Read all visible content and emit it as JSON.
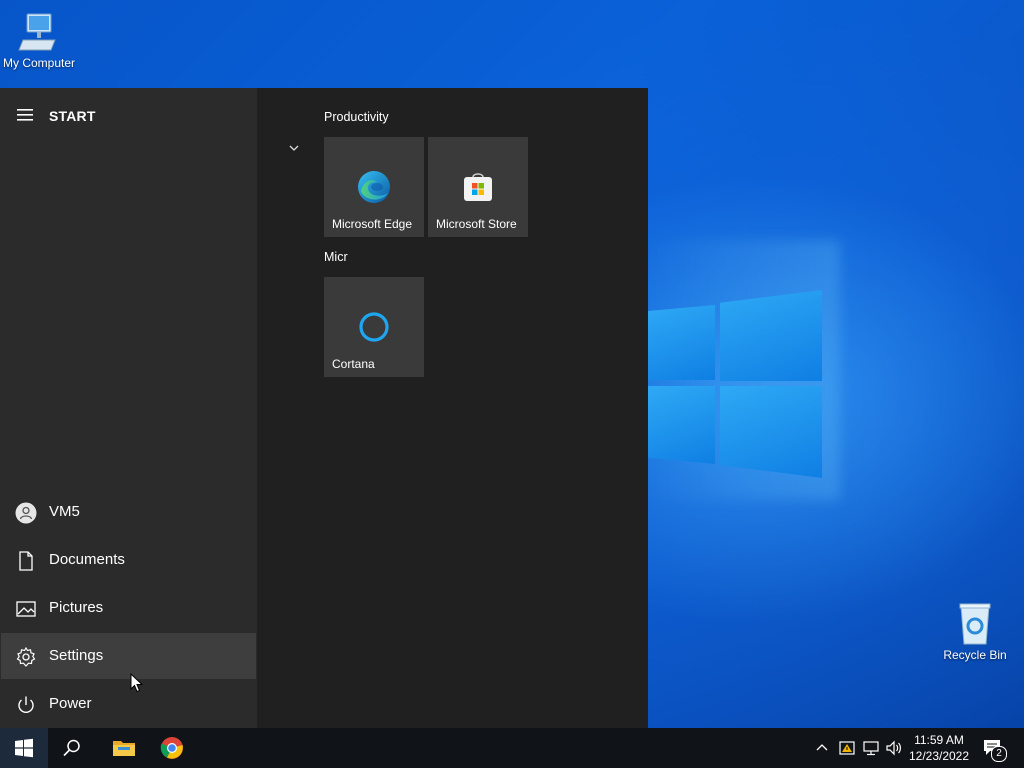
{
  "desktop": {
    "icons": [
      {
        "label": "My Computer"
      },
      {
        "label": "Recycle Bin"
      }
    ]
  },
  "start_menu": {
    "header": {
      "title": "START"
    },
    "left_items": [
      {
        "label": "VM5",
        "icon": "user-avatar-icon"
      },
      {
        "label": "Documents",
        "icon": "document-icon"
      },
      {
        "label": "Pictures",
        "icon": "pictures-icon"
      },
      {
        "label": "Settings",
        "icon": "gear-icon",
        "hovered": true
      },
      {
        "label": "Power",
        "icon": "power-icon"
      }
    ],
    "groups": [
      {
        "title": "Productivity",
        "tiles": [
          {
            "label": "Microsoft Edge"
          },
          {
            "label": "Microsoft Store"
          }
        ]
      },
      {
        "title": "Micr",
        "tiles": [
          {
            "label": "Cortana"
          }
        ]
      }
    ]
  },
  "taskbar": {
    "clock": {
      "time": "11:59 AM",
      "date": "12/23/2022"
    },
    "notification_count": "2"
  },
  "colors": {
    "start_bg": "#202020",
    "start_left_bg": "#2b2b2b",
    "tile_bg": "#3a3a3a",
    "taskbar_bg": "#101418",
    "wallpaper_blue": "#0a61d8"
  }
}
